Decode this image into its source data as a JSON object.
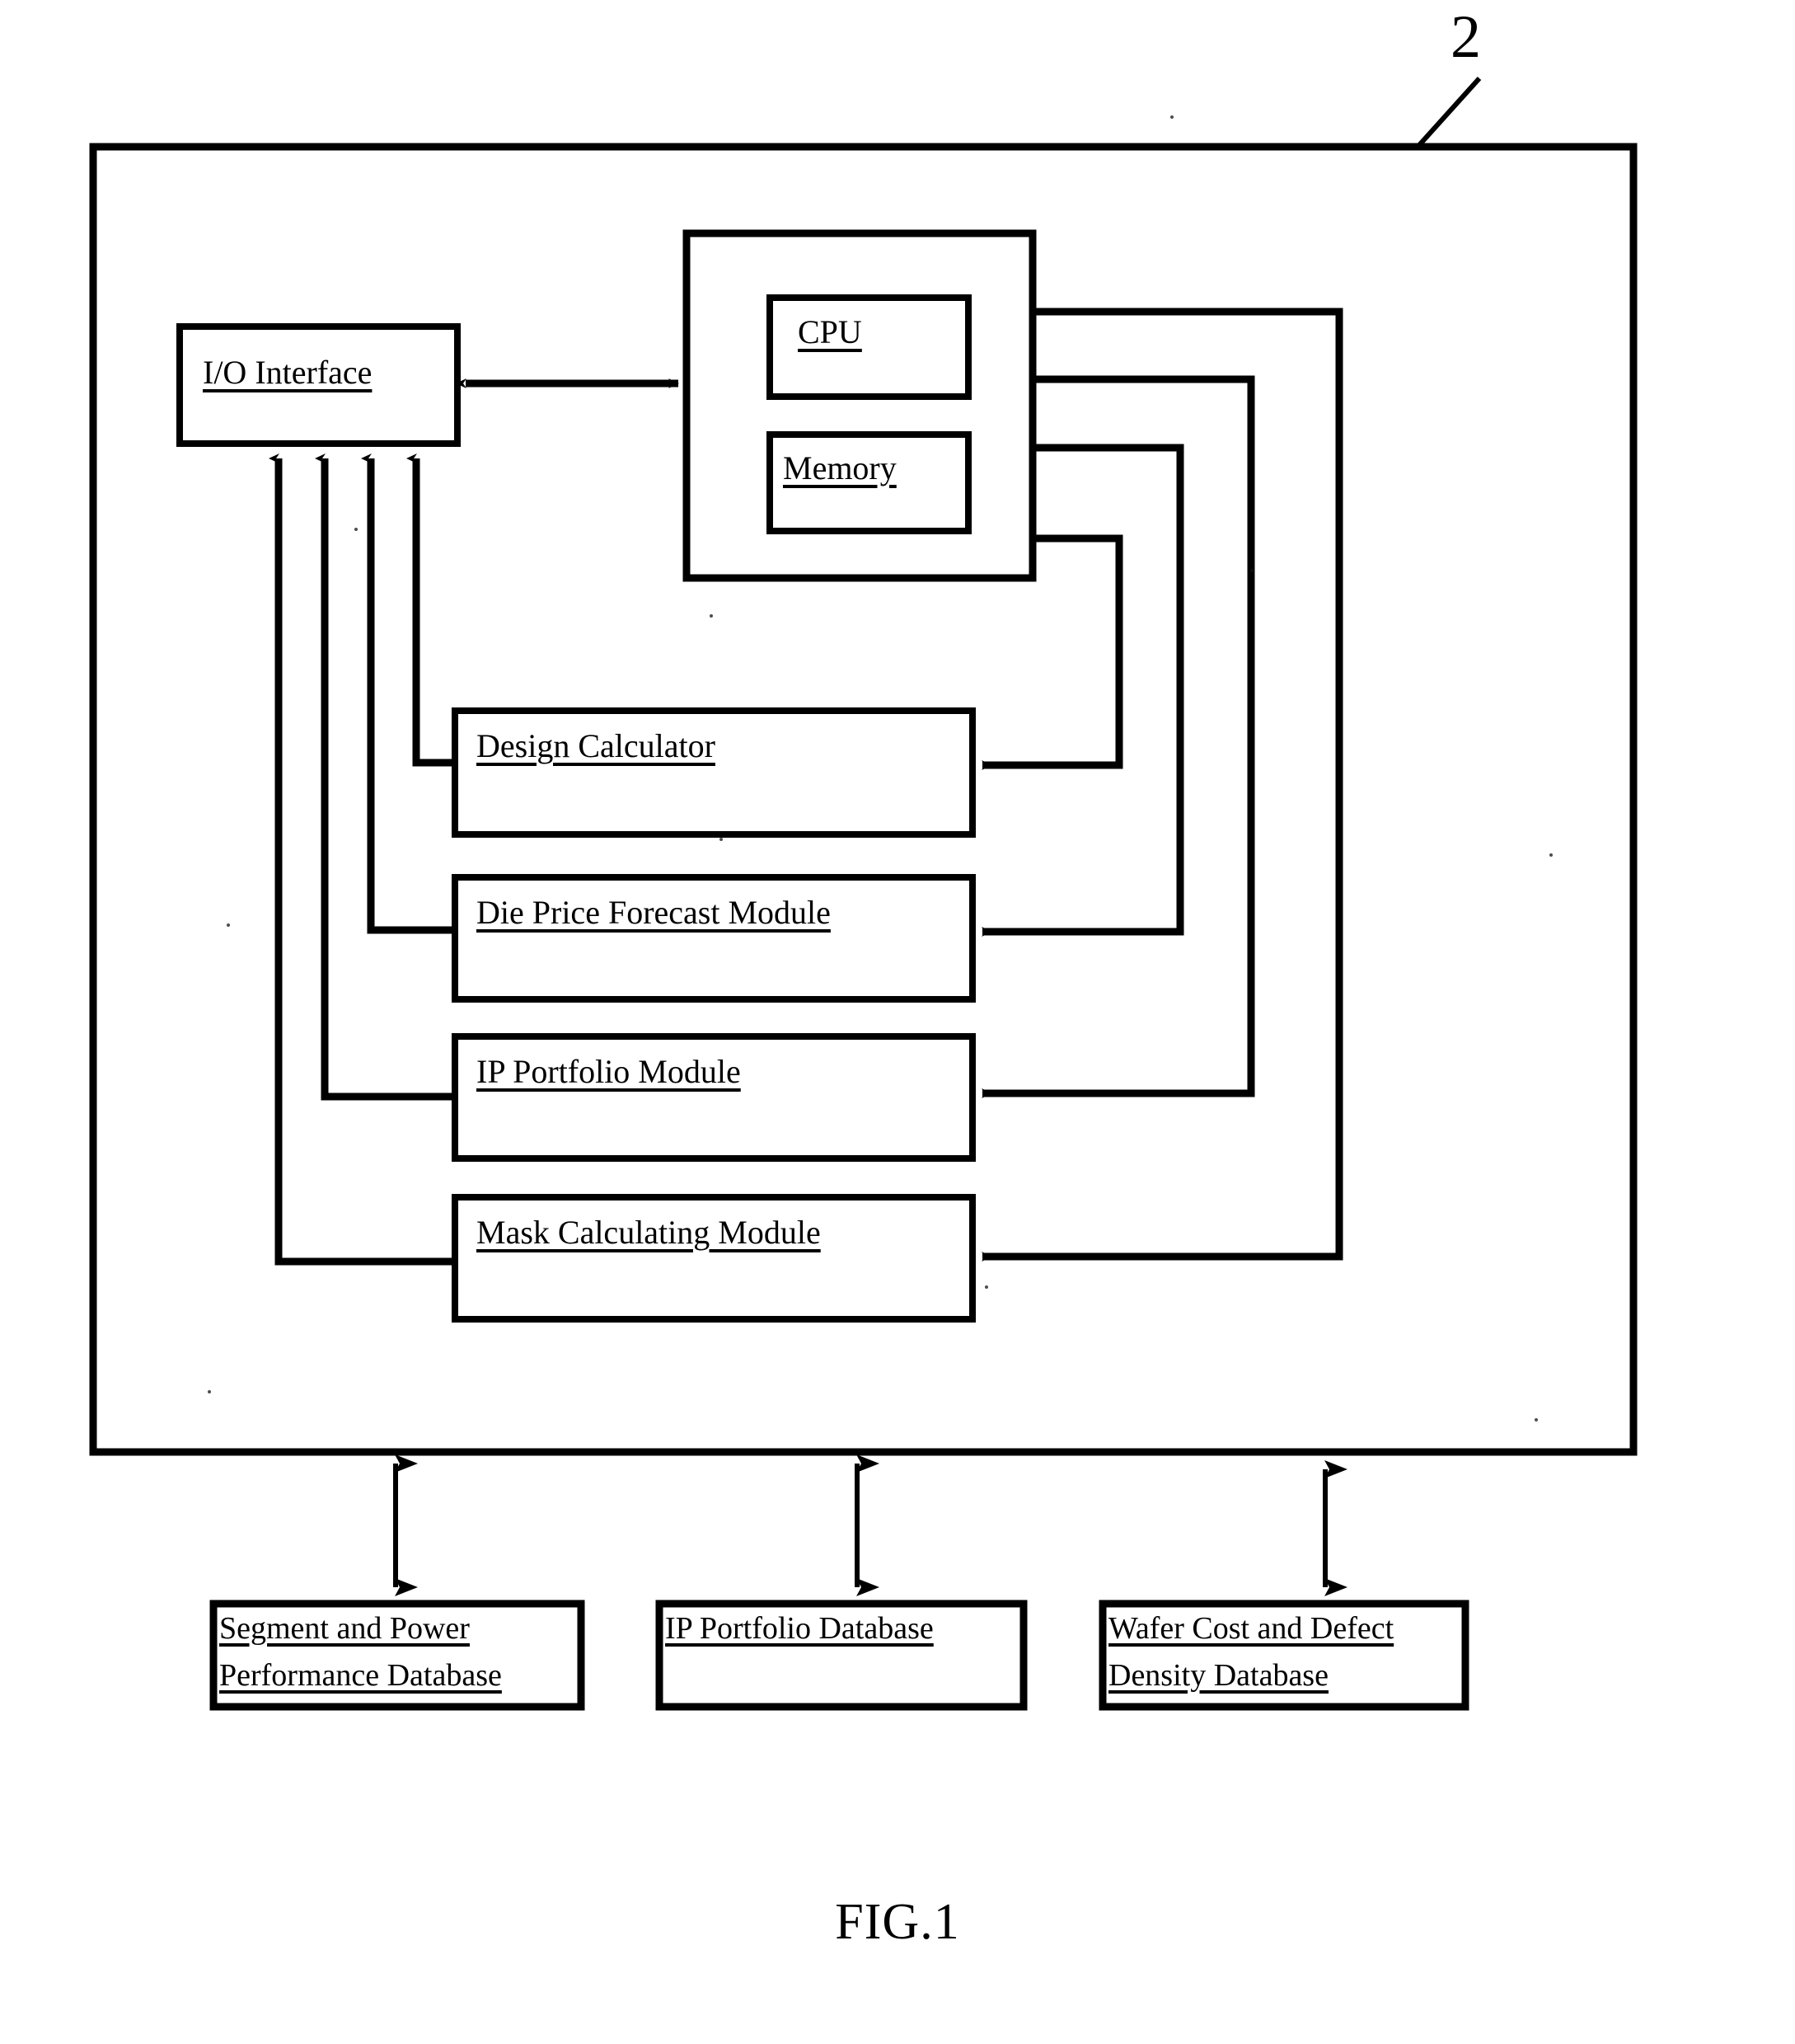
{
  "figure": {
    "caption": "FIG.1",
    "reference_numeral": "2",
    "ink_color": "#000000",
    "background_color": "#ffffff"
  },
  "system_frame": {
    "name": "system-enclosure",
    "reference_numeral": "2"
  },
  "blocks": {
    "io_interface": {
      "label": "I/O Interface"
    },
    "computer": {
      "label": ""
    },
    "cpu": {
      "label": "CPU"
    },
    "memory": {
      "label": "Memory"
    },
    "design_calculator": {
      "label": "Design Calculator"
    },
    "die_price_forecast": {
      "label": "Die Price Forecast Module"
    },
    "ip_portfolio": {
      "label": "IP Portfolio Module"
    },
    "mask_calculating": {
      "label": "Mask Calculating Module"
    }
  },
  "databases": [
    {
      "line1": "Segment and Power",
      "line2": "Performance Database"
    },
    {
      "line1": "IP Portfolio Database",
      "line2": ""
    },
    {
      "line1": "Wafer Cost and Defect",
      "line2": "Density Database"
    }
  ],
  "connections": {
    "io_to_computer": "bidirectional",
    "modules_to_io": "upward",
    "computer_to_modules": "leftward",
    "frame_to_databases": "bidirectional"
  }
}
